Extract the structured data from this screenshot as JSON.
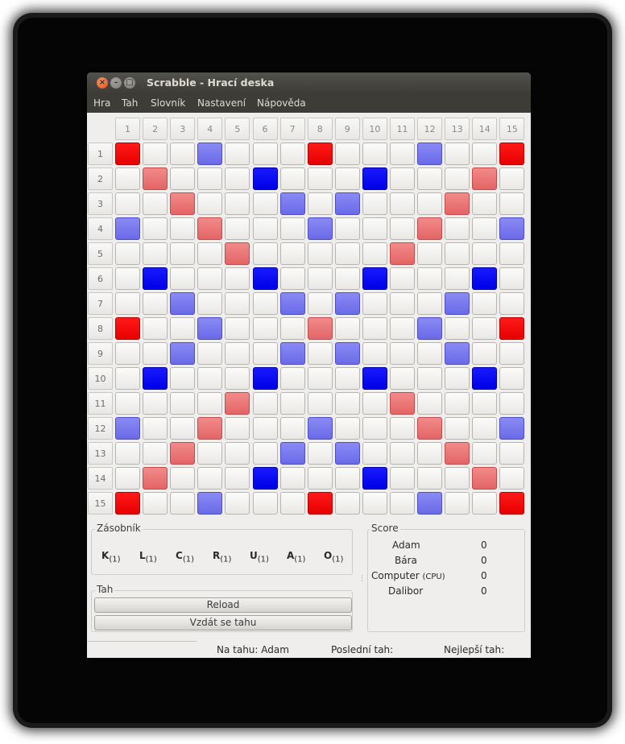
{
  "window": {
    "title": "Scrabble - Hrací deska",
    "buttons": {
      "close": "×",
      "minimize": "–",
      "maximize": "□"
    }
  },
  "menu": [
    "Hra",
    "Tah",
    "Slovník",
    "Nastavení",
    "Nápověda"
  ],
  "board": {
    "columns": [
      "1",
      "2",
      "3",
      "4",
      "5",
      "6",
      "7",
      "8",
      "9",
      "10",
      "11",
      "12",
      "13",
      "14",
      "15"
    ],
    "rows": [
      "1",
      "2",
      "3",
      "4",
      "5",
      "6",
      "7",
      "8",
      "9",
      "10",
      "11",
      "12",
      "13",
      "14",
      "15"
    ],
    "premium_colors": {
      "tw": "#ff0000",
      "dw": "#e86b6b",
      "tl": "#0000ff",
      "dl": "#6e6ee8"
    }
  },
  "rack": {
    "label": "Zásobník",
    "tiles": [
      {
        "letter": "K",
        "value": "(1)"
      },
      {
        "letter": "L",
        "value": "(1)"
      },
      {
        "letter": "C",
        "value": "(1)"
      },
      {
        "letter": "R",
        "value": "(1)"
      },
      {
        "letter": "U",
        "value": "(1)"
      },
      {
        "letter": "A",
        "value": "(1)"
      },
      {
        "letter": "O",
        "value": "(1)"
      }
    ]
  },
  "turn": {
    "label": "Tah",
    "reload": "Reload",
    "pass": "Vzdát se tahu"
  },
  "score": {
    "label": "Score",
    "players": [
      {
        "name": "Adam",
        "tag": "",
        "score": "0"
      },
      {
        "name": "Bára",
        "tag": "",
        "score": "0"
      },
      {
        "name": "Computer",
        "tag": "(CPU)",
        "score": "0"
      },
      {
        "name": "Dalibor",
        "tag": "",
        "score": "0"
      }
    ]
  },
  "status": {
    "on_turn": "Na tahu: Adam",
    "last_move": "Poslední tah:",
    "best_move": "Nejlepší tah:"
  }
}
